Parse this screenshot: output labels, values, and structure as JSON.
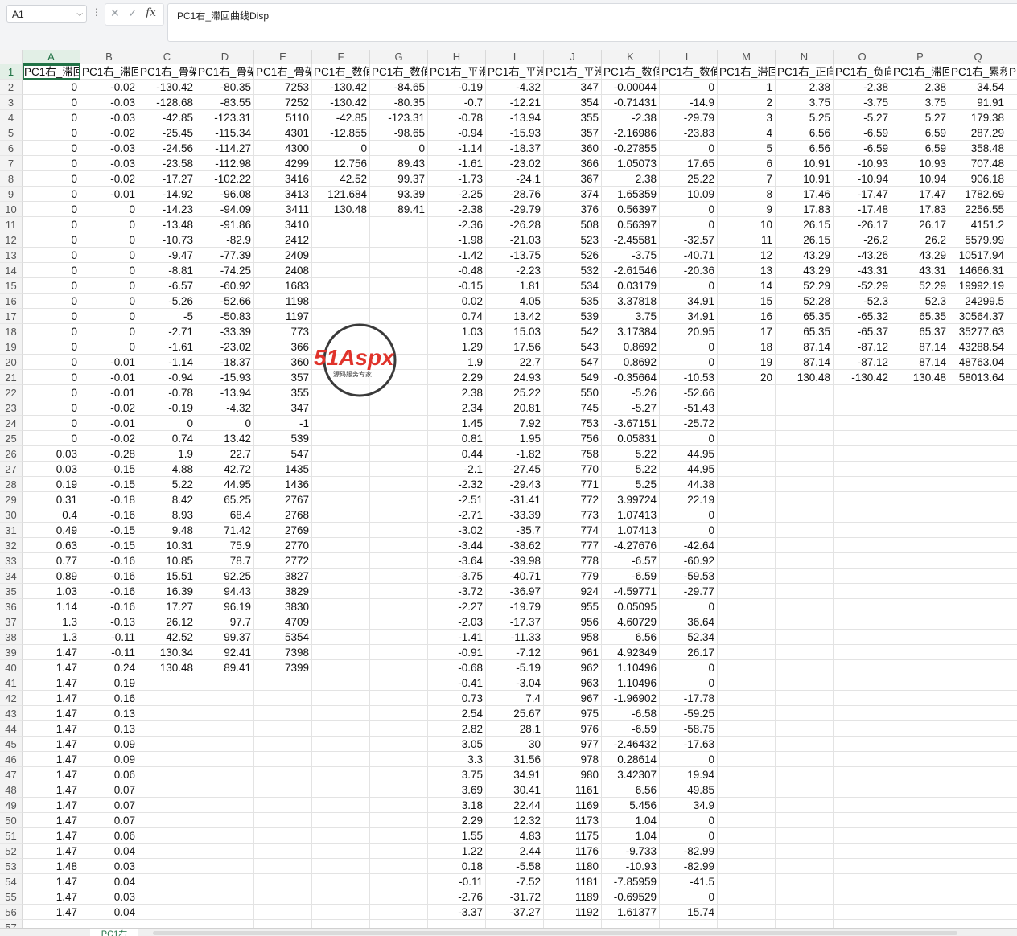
{
  "formula_bar": {
    "cell_ref": "A1",
    "more_glyph": "⋮",
    "cancel_glyph": "✕",
    "confirm_glyph": "✓",
    "fx_glyph": "fx",
    "content": "PC1右_滞回曲线Disp"
  },
  "columns": [
    "A",
    "B",
    "C",
    "D",
    "E",
    "F",
    "G",
    "H",
    "I",
    "J",
    "K",
    "L",
    "M",
    "N",
    "O",
    "P",
    "Q"
  ],
  "headers": [
    "PC1右_滞回",
    "PC1右_滞回",
    "PC1右_骨架",
    "PC1右_骨架",
    "PC1右_骨架",
    "PC1右_数值",
    "PC1右_数值",
    "PC1右_平滑",
    "PC1右_平滑",
    "PC1右_平滑",
    "PC1右_数值",
    "PC1右_数值",
    "PC1右_滞回",
    "PC1右_正向",
    "PC1右_负向",
    "PC1右_滞回",
    "PC1右_累积",
    "P"
  ],
  "colA": [
    "0",
    "0",
    "0",
    "0",
    "0",
    "0",
    "0",
    "0",
    "0",
    "0",
    "0",
    "0",
    "0",
    "0",
    "0",
    "0",
    "0",
    "0",
    "0",
    "0",
    "0",
    "0",
    "0",
    "0",
    "0.03",
    "0.03",
    "0.19",
    "0.31",
    "0.4",
    "0.49",
    "0.63",
    "0.77",
    "0.89",
    "1.03",
    "1.14",
    "1.3",
    "1.3",
    "1.47",
    "1.47",
    "1.47",
    "1.47",
    "1.47",
    "1.47",
    "1.47",
    "1.47",
    "1.47",
    "1.47",
    "1.47",
    "1.47",
    "1.47",
    "1.47",
    "1.48",
    "1.47",
    "1.47",
    "1.47"
  ],
  "colB": [
    "-0.02",
    "-0.03",
    "-0.03",
    "-0.02",
    "-0.03",
    "-0.03",
    "-0.02",
    "-0.01",
    "0",
    "0",
    "0",
    "0",
    "0",
    "0",
    "0",
    "0",
    "0",
    "0",
    "-0.01",
    "-0.01",
    "-0.01",
    "-0.02",
    "-0.01",
    "-0.02",
    "-0.28",
    "-0.15",
    "-0.15",
    "-0.18",
    "-0.16",
    "-0.15",
    "-0.15",
    "-0.16",
    "-0.16",
    "-0.16",
    "-0.16",
    "-0.13",
    "-0.11",
    "-0.11",
    "0.24",
    "0.19",
    "0.16",
    "0.13",
    "0.13",
    "0.09",
    "0.09",
    "0.06",
    "0.07",
    "0.07",
    "0.07",
    "0.06",
    "0.04",
    "0.03",
    "0.04",
    "0.03",
    "0.04"
  ],
  "colC": [
    "-130.42",
    "-128.68",
    "-42.85",
    "-25.45",
    "-24.56",
    "-23.58",
    "-17.27",
    "-14.92",
    "-14.23",
    "-13.48",
    "-10.73",
    "-9.47",
    "-8.81",
    "-6.57",
    "-5.26",
    "-5",
    "-2.71",
    "-1.61",
    "-1.14",
    "-0.94",
    "-0.78",
    "-0.19",
    "0",
    "0.74",
    "1.9",
    "4.88",
    "5.22",
    "8.42",
    "8.93",
    "9.48",
    "10.31",
    "10.85",
    "15.51",
    "16.39",
    "17.27",
    "26.12",
    "42.52",
    "130.34",
    "130.48"
  ],
  "colD": [
    "-80.35",
    "-83.55",
    "-123.31",
    "-115.34",
    "-114.27",
    "-112.98",
    "-102.22",
    "-96.08",
    "-94.09",
    "-91.86",
    "-82.9",
    "-77.39",
    "-74.25",
    "-60.92",
    "-52.66",
    "-50.83",
    "-33.39",
    "-23.02",
    "-18.37",
    "-15.93",
    "-13.94",
    "-4.32",
    "0",
    "13.42",
    "22.7",
    "42.72",
    "44.95",
    "65.25",
    "68.4",
    "71.42",
    "75.9",
    "78.7",
    "92.25",
    "94.43",
    "96.19",
    "97.7",
    "99.37",
    "92.41",
    "89.41"
  ],
  "colE": [
    "7253",
    "7252",
    "5110",
    "4301",
    "4300",
    "4299",
    "3416",
    "3413",
    "3411",
    "3410",
    "2412",
    "2409",
    "2408",
    "1683",
    "1198",
    "1197",
    "773",
    "366",
    "360",
    "357",
    "355",
    "347",
    "-1",
    "539",
    "547",
    "1435",
    "1436",
    "2767",
    "2768",
    "2769",
    "2770",
    "2772",
    "3827",
    "3829",
    "3830",
    "4709",
    "5354",
    "7398",
    "7399"
  ],
  "colF": [
    "-130.42",
    "-130.42",
    "-42.85",
    "-12.855",
    "0",
    "12.756",
    "42.52",
    "121.684",
    "130.48"
  ],
  "colG": [
    "-84.65",
    "-80.35",
    "-123.31",
    "-98.65",
    "0",
    "89.43",
    "99.37",
    "93.39",
    "89.41"
  ],
  "colH": [
    "-0.19",
    "-0.7",
    "-0.78",
    "-0.94",
    "-1.14",
    "-1.61",
    "-1.73",
    "-2.25",
    "-2.38",
    "-2.36",
    "-1.98",
    "-1.42",
    "-0.48",
    "-0.15",
    "0.02",
    "0.74",
    "1.03",
    "1.29",
    "1.9",
    "2.29",
    "2.38",
    "2.34",
    "1.45",
    "0.81",
    "0.44",
    "-2.1",
    "-2.32",
    "-2.51",
    "-2.71",
    "-3.02",
    "-3.44",
    "-3.64",
    "-3.75",
    "-3.72",
    "-2.27",
    "-2.03",
    "-1.41",
    "-0.91",
    "-0.68",
    "-0.41",
    "0.73",
    "2.54",
    "2.82",
    "3.05",
    "3.3",
    "3.75",
    "3.69",
    "3.18",
    "2.29",
    "1.55",
    "1.22",
    "0.18",
    "-0.11",
    "-2.76",
    "-3.37"
  ],
  "colI": [
    "-4.32",
    "-12.21",
    "-13.94",
    "-15.93",
    "-18.37",
    "-23.02",
    "-24.1",
    "-28.76",
    "-29.79",
    "-26.28",
    "-21.03",
    "-13.75",
    "-2.23",
    "1.81",
    "4.05",
    "13.42",
    "15.03",
    "17.56",
    "22.7",
    "24.93",
    "25.22",
    "20.81",
    "7.92",
    "1.95",
    "-1.82",
    "-27.45",
    "-29.43",
    "-31.41",
    "-33.39",
    "-35.7",
    "-38.62",
    "-39.98",
    "-40.71",
    "-36.97",
    "-19.79",
    "-17.37",
    "-11.33",
    "-7.12",
    "-5.19",
    "-3.04",
    "7.4",
    "25.67",
    "28.1",
    "30",
    "31.56",
    "34.91",
    "30.41",
    "22.44",
    "12.32",
    "4.83",
    "2.44",
    "-5.58",
    "-7.52",
    "-31.72",
    "-37.27"
  ],
  "colJ": [
    "347",
    "354",
    "355",
    "357",
    "360",
    "366",
    "367",
    "374",
    "376",
    "508",
    "523",
    "526",
    "532",
    "534",
    "535",
    "539",
    "542",
    "543",
    "547",
    "549",
    "550",
    "745",
    "753",
    "756",
    "758",
    "770",
    "771",
    "772",
    "773",
    "774",
    "777",
    "778",
    "779",
    "924",
    "955",
    "956",
    "958",
    "961",
    "962",
    "963",
    "967",
    "975",
    "976",
    "977",
    "978",
    "980",
    "1161",
    "1169",
    "1173",
    "1175",
    "1176",
    "1180",
    "1181",
    "1189",
    "1192"
  ],
  "colK": [
    "-0.00044",
    "-0.71431",
    "-2.38",
    "-2.16986",
    "-0.27855",
    "1.05073",
    "2.38",
    "1.65359",
    "0.56397",
    "0.56397",
    "-2.45581",
    "-3.75",
    "-2.61546",
    "0.03179",
    "3.37818",
    "3.75",
    "3.17384",
    "0.8692",
    "0.8692",
    "-0.35664",
    "-5.26",
    "-5.27",
    "-3.67151",
    "0.05831",
    "5.22",
    "5.22",
    "5.25",
    "3.99724",
    "1.07413",
    "1.07413",
    "-4.27676",
    "-6.57",
    "-6.59",
    "-4.59771",
    "0.05095",
    "4.60729",
    "6.56",
    "4.92349",
    "1.10496",
    "1.10496",
    "-1.96902",
    "-6.58",
    "-6.59",
    "-2.46432",
    "0.28614",
    "3.42307",
    "6.56",
    "5.456",
    "1.04",
    "1.04",
    "-9.733",
    "-10.93",
    "-7.85959",
    "-0.69529",
    "1.61377"
  ],
  "colL": [
    "0",
    "-14.9",
    "-29.79",
    "-23.83",
    "0",
    "17.65",
    "25.22",
    "10.09",
    "0",
    "0",
    "-32.57",
    "-40.71",
    "-20.36",
    "0",
    "34.91",
    "34.91",
    "20.95",
    "0",
    "0",
    "-10.53",
    "-52.66",
    "-51.43",
    "-25.72",
    "0",
    "44.95",
    "44.95",
    "44.38",
    "22.19",
    "0",
    "0",
    "-42.64",
    "-60.92",
    "-59.53",
    "-29.77",
    "0",
    "36.64",
    "52.34",
    "26.17",
    "0",
    "0",
    "-17.78",
    "-59.25",
    "-58.75",
    "-17.63",
    "0",
    "19.94",
    "49.85",
    "34.9",
    "0",
    "0",
    "-82.99",
    "-82.99",
    "-41.5",
    "0",
    "15.74"
  ],
  "colM": [
    "1",
    "2",
    "3",
    "4",
    "5",
    "6",
    "7",
    "8",
    "9",
    "10",
    "11",
    "12",
    "13",
    "14",
    "15",
    "16",
    "17",
    "18",
    "19",
    "20"
  ],
  "colN": [
    "2.38",
    "3.75",
    "5.25",
    "6.56",
    "6.56",
    "10.91",
    "10.91",
    "17.46",
    "17.83",
    "26.15",
    "26.15",
    "43.29",
    "43.29",
    "52.29",
    "52.28",
    "65.35",
    "65.35",
    "87.14",
    "87.14",
    "130.48"
  ],
  "colO": [
    "-2.38",
    "-3.75",
    "-5.27",
    "-6.59",
    "-6.59",
    "-10.93",
    "-10.94",
    "-17.47",
    "-17.48",
    "-26.17",
    "-26.2",
    "-43.26",
    "-43.31",
    "-52.29",
    "-52.3",
    "-65.32",
    "-65.37",
    "-87.12",
    "-87.12",
    "-130.42"
  ],
  "colP": [
    "2.38",
    "3.75",
    "5.27",
    "6.59",
    "6.59",
    "10.93",
    "10.94",
    "17.47",
    "17.83",
    "26.17",
    "26.2",
    "43.29",
    "43.31",
    "52.29",
    "52.3",
    "65.35",
    "65.37",
    "87.14",
    "87.14",
    "130.48"
  ],
  "colQ": [
    "34.54",
    "91.91",
    "179.38",
    "287.29",
    "358.48",
    "707.48",
    "906.18",
    "1782.69",
    "2256.55",
    "4151.2",
    "5579.99",
    "10517.94",
    "14666.31",
    "19992.19",
    "24299.5",
    "30564.37",
    "35277.63",
    "43288.54",
    "48763.04",
    "58013.64"
  ],
  "watermark": {
    "logo": "51Aspx",
    "tagline": "源码服务专家"
  },
  "sheet_tab": "PC1右"
}
